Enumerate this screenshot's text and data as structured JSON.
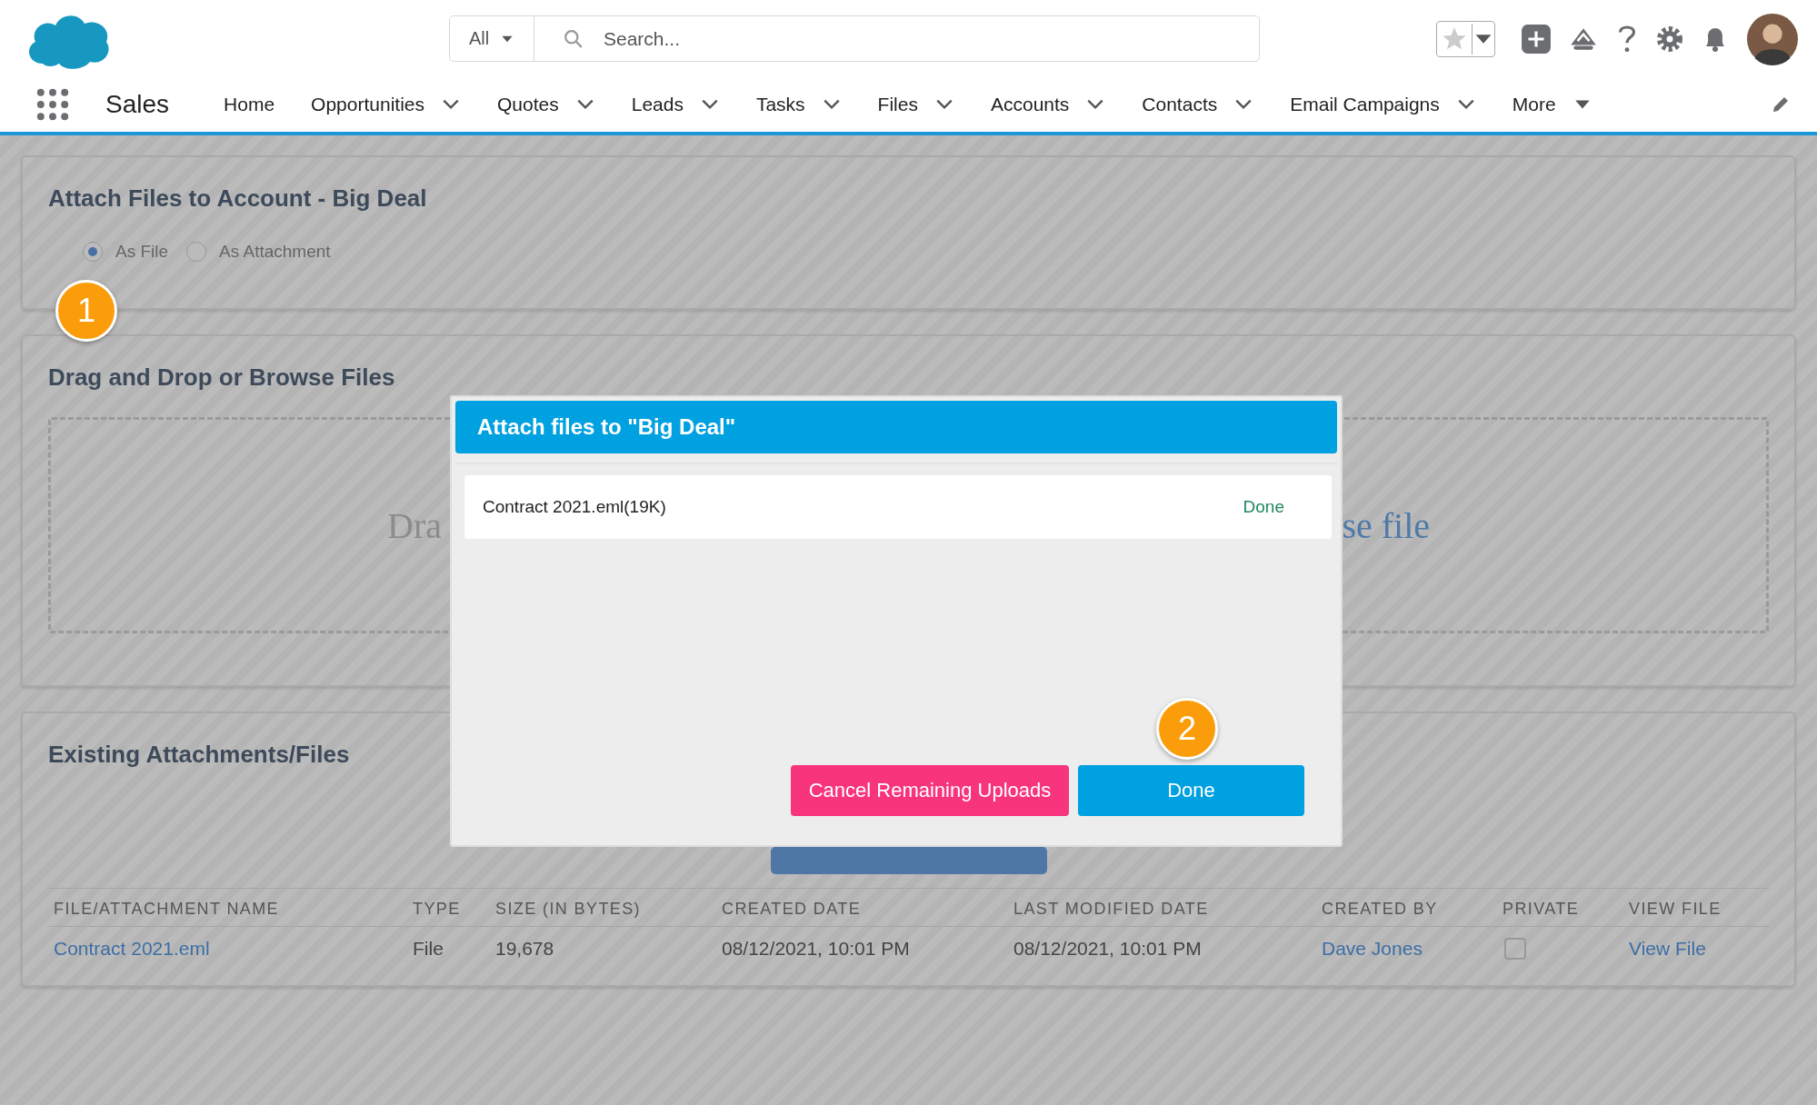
{
  "header": {
    "search": {
      "scope": "All",
      "placeholder": "Search..."
    }
  },
  "nav": {
    "app_name": "Sales",
    "items": [
      {
        "label": "Home",
        "kind": "plain"
      },
      {
        "label": "Opportunities",
        "kind": "dropdown"
      },
      {
        "label": "Quotes",
        "kind": "dropdown"
      },
      {
        "label": "Leads",
        "kind": "dropdown"
      },
      {
        "label": "Tasks",
        "kind": "dropdown"
      },
      {
        "label": "Files",
        "kind": "dropdown"
      },
      {
        "label": "Accounts",
        "kind": "dropdown"
      },
      {
        "label": "Contacts",
        "kind": "dropdown"
      },
      {
        "label": "Email Campaigns",
        "kind": "dropdown"
      },
      {
        "label": "More",
        "kind": "overflow"
      }
    ]
  },
  "attach_panel": {
    "title": "Attach Files to Account - Big Deal",
    "options": [
      {
        "label": "As File",
        "selected": true
      },
      {
        "label": "As Attachment",
        "selected": false
      }
    ]
  },
  "drop_panel": {
    "title": "Drag and Drop or Browse Files",
    "text_left": "Dra",
    "text_right": "se file"
  },
  "existing_panel": {
    "title": "Existing Attachments/Files",
    "columns": [
      "FILE/ATTACHMENT NAME",
      "TYPE",
      "SIZE (IN BYTES)",
      "CREATED DATE",
      "LAST MODIFIED DATE",
      "CREATED BY",
      "PRIVATE",
      "VIEW FILE"
    ],
    "rows": [
      {
        "cells": [
          {
            "kind": "link",
            "text": "Contract 2021.eml"
          },
          {
            "kind": "text",
            "text": "File"
          },
          {
            "kind": "text",
            "text": "19,678"
          },
          {
            "kind": "text",
            "text": "08/12/2021, 10:01 PM"
          },
          {
            "kind": "text",
            "text": "08/12/2021, 10:01 PM"
          },
          {
            "kind": "link",
            "text": "Dave Jones"
          },
          {
            "kind": "checkbox",
            "checked": false
          },
          {
            "kind": "link",
            "text": "View File"
          }
        ]
      }
    ]
  },
  "modal": {
    "title": "Attach files to \"Big Deal\"",
    "uploads": [
      {
        "name": "Contract 2021.eml(19K)",
        "status": "Done"
      }
    ],
    "buttons": [
      {
        "label": "Cancel Remaining Uploads",
        "kind": "danger"
      },
      {
        "label": "Done",
        "kind": "primary"
      }
    ]
  },
  "callouts": [
    {
      "label": "1"
    },
    {
      "label": "2"
    }
  ]
}
